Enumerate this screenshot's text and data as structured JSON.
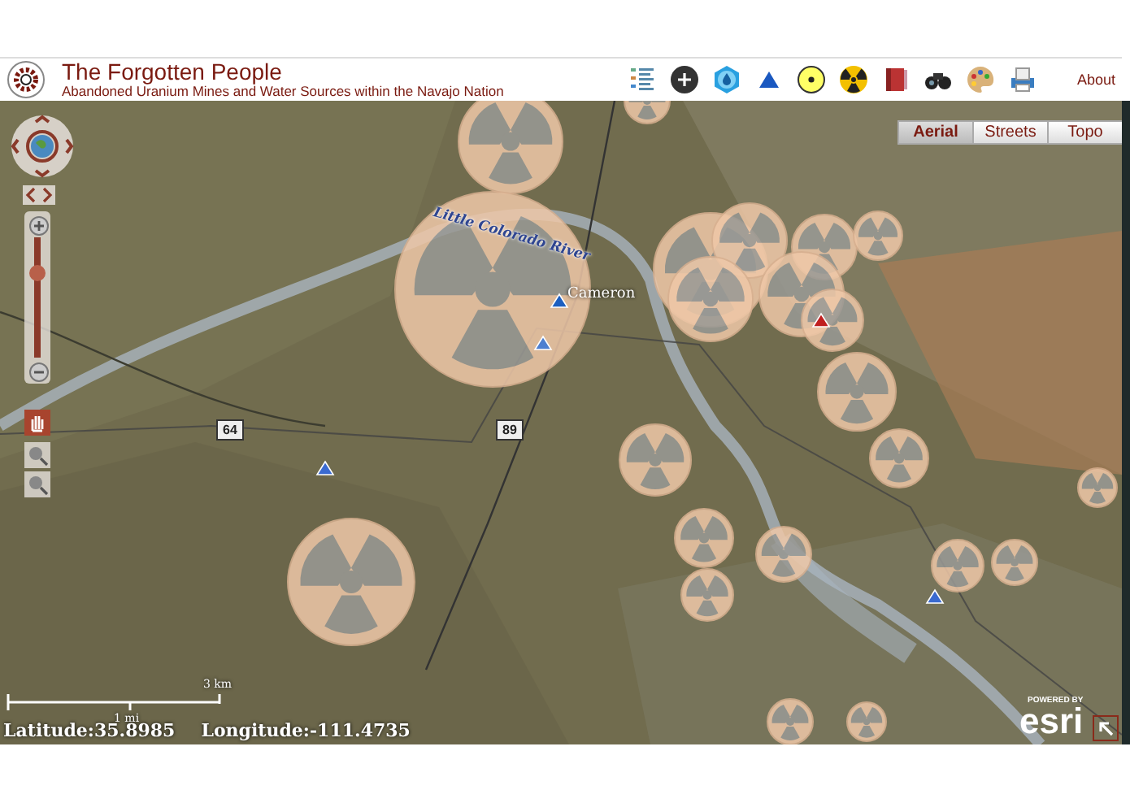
{
  "header": {
    "title": "The Forgotten People",
    "subtitle": "Abandoned Uranium Mines and Water Sources within the Navajo Nation",
    "about_link": "About"
  },
  "basemap_buttons": [
    {
      "label": "Aerial",
      "selected": true
    },
    {
      "label": "Streets",
      "selected": false
    },
    {
      "label": "Topo",
      "selected": false
    }
  ],
  "map": {
    "river_label": "Little Colorado River",
    "place_label": "Cameron",
    "highway_shields": [
      "64",
      "89"
    ],
    "zoom_slider": {
      "level": 0.7
    },
    "scale_bar": {
      "metric": "3 km",
      "imperial": "1 mi"
    },
    "coordinates": {
      "latitude": "Latitude:35.8985",
      "longitude": "Longitude:-111.4735"
    },
    "attribution": {
      "powered_by": "POWERED BY",
      "logo": "esri"
    }
  }
}
